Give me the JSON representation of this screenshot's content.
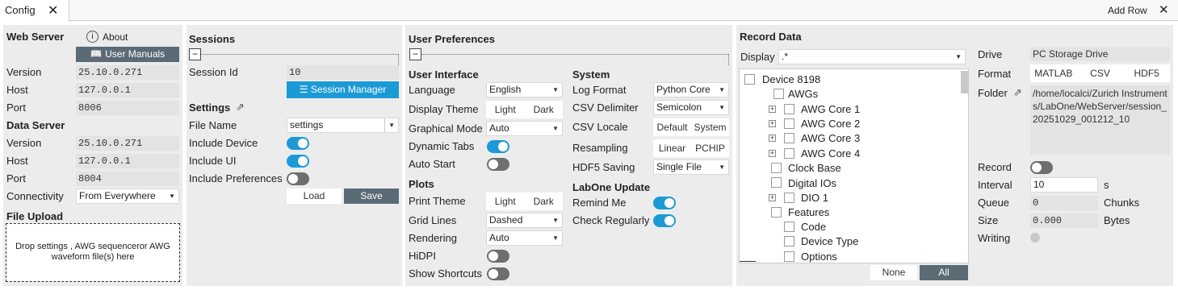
{
  "tabs": {
    "active": "Config",
    "add_row": "Add Row"
  },
  "web_server": {
    "title": "Web Server",
    "about": "About",
    "manuals": "User Manuals",
    "version_label": "Version",
    "version": "25.10.0.271",
    "host_label": "Host",
    "host": "127.0.0.1",
    "port_label": "Port",
    "port": "8006"
  },
  "data_server": {
    "title": "Data Server",
    "version_label": "Version",
    "version": "25.10.0.271",
    "host_label": "Host",
    "host": "127.0.0.1",
    "port_label": "Port",
    "port": "8004",
    "connectivity_label": "Connectivity",
    "connectivity": "From Everywhere"
  },
  "file_upload": {
    "title": "File Upload",
    "drop_text": "Drop settings , AWG sequenceror AWG waveform file(s) here"
  },
  "sessions": {
    "title": "Sessions",
    "session_id_label": "Session Id",
    "session_id": "10",
    "manager_label": "Session Manager"
  },
  "settings": {
    "title": "Settings",
    "file_name_label": "File Name",
    "file_name": "settings",
    "include_device_label": "Include Device",
    "include_ui_label": "Include UI",
    "include_prefs_label": "Include Preferences",
    "load": "Load",
    "save": "Save"
  },
  "prefs": {
    "title": "User Preferences",
    "ui": {
      "title": "User Interface",
      "language_label": "Language",
      "language": "English",
      "theme_label": "Display Theme",
      "theme_light": "Light",
      "theme_dark": "Dark",
      "gmode_label": "Graphical Mode",
      "gmode": "Auto",
      "dyntabs_label": "Dynamic Tabs",
      "autostart_label": "Auto Start"
    },
    "plots": {
      "title": "Plots",
      "print_theme_label": "Print Theme",
      "light": "Light",
      "dark": "Dark",
      "grid_label": "Grid Lines",
      "grid": "Dashed",
      "rendering_label": "Rendering",
      "rendering": "Auto",
      "hidpi_label": "HiDPI",
      "shortcuts_label": "Show Shortcuts"
    },
    "system": {
      "title": "System",
      "log_label": "Log Format",
      "log": "Python Core",
      "csvdelim_label": "CSV Delimiter",
      "csvdelim": "Semicolon",
      "csvlocale_label": "CSV Locale",
      "locale_default": "Default",
      "locale_system": "System",
      "resampling_label": "Resampling",
      "linear": "Linear",
      "pchip": "PCHIP",
      "hdf5_label": "HDF5 Saving",
      "hdf5": "Single File"
    },
    "update": {
      "title": "LabOne Update",
      "remind_label": "Remind Me",
      "check_label": "Check Regularly"
    }
  },
  "record": {
    "title": "Record Data",
    "display_label": "Display",
    "display_value": ".*",
    "tree": [
      "Device 8198",
      "AWGs",
      "AWG Core 1",
      "AWG Core 2",
      "AWG Core 3",
      "AWG Core 4",
      "Clock Base",
      "Digital IOs",
      "DIO 1",
      "Features",
      "Code",
      "Device Type",
      "Options"
    ],
    "none": "None",
    "all": "All",
    "drive_label": "Drive",
    "drive": "PC Storage Drive",
    "format_label": "Format",
    "fmt_matlab": "MATLAB",
    "fmt_csv": "CSV",
    "fmt_hdf5": "HDF5",
    "folder_label": "Folder",
    "folder": "/home/localci/Zurich Instruments/LabOne/WebServer/session_20251029_001212_10",
    "record_label": "Record",
    "interval_label": "Interval",
    "interval": "10",
    "interval_unit": "s",
    "queue_label": "Queue",
    "queue": "0",
    "queue_unit": "Chunks",
    "size_label": "Size",
    "size": "0.000",
    "size_unit": "Bytes",
    "writing_label": "Writing"
  }
}
